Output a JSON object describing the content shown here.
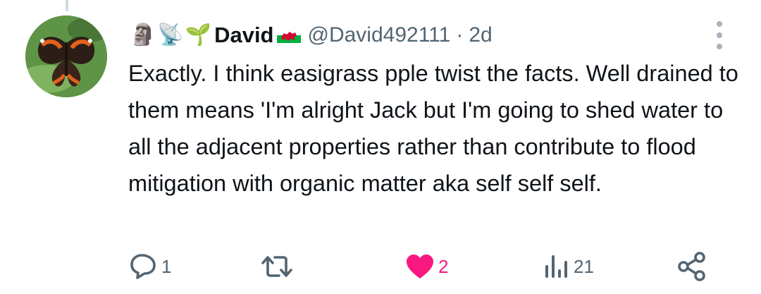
{
  "author": {
    "emojis": [
      "🗿",
      "📡",
      "🌱"
    ],
    "name": "David",
    "handle": "@David492111",
    "separator": "·",
    "timestamp": "2d"
  },
  "tweet": {
    "text": "Exactly. I think easigrass pple twist the facts. Well drained to them means 'I'm alright Jack but I'm going to shed water to all the adjacent properties rather than contribute to flood mitigation with organic matter aka self self self."
  },
  "actions": {
    "reply_count": "1",
    "retweet_count": "",
    "like_count": "2",
    "views_count": "21"
  },
  "colors": {
    "text": "#0f1419",
    "secondary": "#536471",
    "like": "#f91880",
    "thread_line": "#cfd9de"
  },
  "icons": [
    "reply-icon",
    "retweet-icon",
    "like-icon",
    "views-icon",
    "share-icon",
    "more-icon",
    "wales-flag-icon"
  ]
}
